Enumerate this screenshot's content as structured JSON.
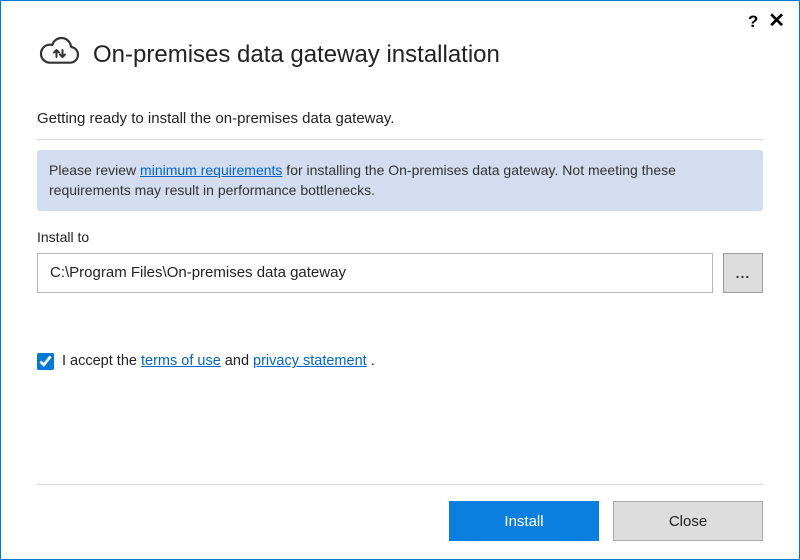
{
  "header": {
    "title": "On-premises data gateway installation"
  },
  "subtitle": "Getting ready to install the on-premises data gateway.",
  "notice": {
    "prefix": "Please review ",
    "link": "minimum requirements",
    "suffix": " for installing the On-premises data gateway. Not meeting these requirements may result in performance bottlenecks."
  },
  "install": {
    "label": "Install to",
    "path": "C:\\Program Files\\On-premises data gateway",
    "browse": "..."
  },
  "consent": {
    "checked": true,
    "prefix": "I accept the ",
    "terms_link": "terms of use",
    "middle": " and ",
    "privacy_link": "privacy statement",
    "suffix": " ."
  },
  "buttons": {
    "install": "Install",
    "close": "Close"
  }
}
